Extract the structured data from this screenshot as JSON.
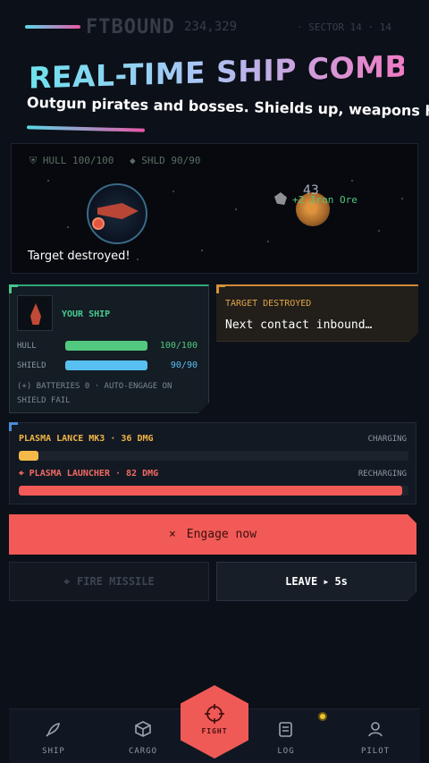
{
  "topbar": {
    "brand": "FTBOUND",
    "credits": "234,329",
    "sector": "· SECTOR 14 · 14"
  },
  "hero": {
    "title": "REAL-TIME SHIP COMBAT",
    "subtitle": "Outgun pirates and bosses. Shields up, weapons hot"
  },
  "viewport": {
    "hull_stat": "⛨ HULL 100/100",
    "shield_stat": "◆ SHLD 90/90",
    "hit_number": "43",
    "loot": "+2 Iron Ore",
    "message": "Target destroyed!"
  },
  "your_ship": {
    "title": "YOUR SHIP",
    "hull_label": "HULL",
    "hull_value": "100/100",
    "hull_fraction": 1.0,
    "shield_label": "SHIELD",
    "shield_value": "90/90",
    "shield_fraction": 1.0,
    "note": "(+) BATTERIES 0 · AUTO-ENGAGE ON SHIELD FAIL"
  },
  "target": {
    "title": "TARGET DESTROYED",
    "text": "Next contact inbound…"
  },
  "weapons": [
    {
      "name": "PLASMA LANCE MK3 · 36 DMG",
      "state": "CHARGING",
      "fraction": 0.05,
      "color": "#f5b94a"
    },
    {
      "name": "⌖ PLASMA LAUNCHER · 82 DMG",
      "state": "RECHARGING",
      "fraction": 0.985,
      "color": "#f15a56"
    }
  ],
  "actions": {
    "engage_icon": "×",
    "engage_label": "Engage now",
    "fire_icon": "⌖",
    "fire_label": "FIRE MISSILE",
    "leave_label": "LEAVE",
    "leave_arrow": "▸",
    "leave_timer": "5s"
  },
  "nav": {
    "ship": "SHIP",
    "cargo": "CARGO",
    "fight": "FIGHT",
    "log": "LOG",
    "pilot": "PILOT"
  },
  "colors": {
    "accent": "#f15a56",
    "success": "#47c98f",
    "shield": "#58c0f0",
    "warning": "#e0a64a"
  }
}
